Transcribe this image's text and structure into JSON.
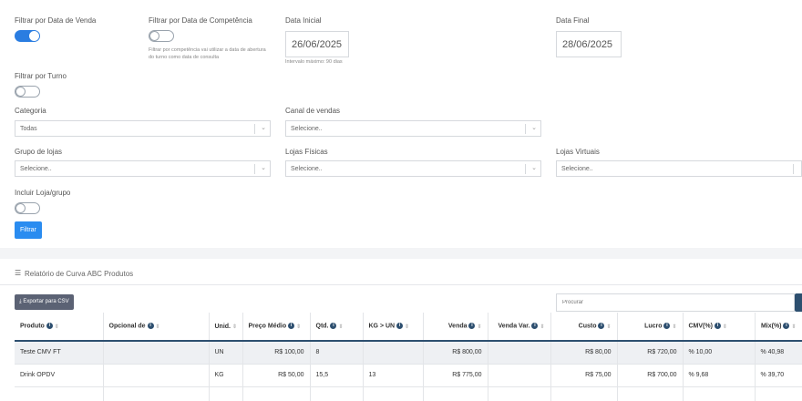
{
  "filters": {
    "data_venda_label": "Filtrar por Data de Venda",
    "data_competencia_label": "Filtrar por Data de Competência",
    "data_competencia_hint": "Filtrar por competência vai utilizar a data de abertura do turno como data de consulta",
    "data_inicial_label": "Data Inicial",
    "data_inicial_value": "26/06/2025",
    "data_inicial_hint": "Intervalo máximo: 90 dias",
    "data_final_label": "Data Final",
    "data_final_value": "28/06/2025",
    "turno_label": "Filtrar por Turno",
    "categoria_label": "Categoria",
    "categoria_value": "Todas",
    "canal_label": "Canal de vendas",
    "canal_value": "Selecione..",
    "grupo_label": "Grupo de lojas",
    "grupo_value": "Selecione..",
    "lojas_fisicas_label": "Lojas Físicas",
    "lojas_fisicas_value": "Selecione..",
    "lojas_virtuais_label": "Lojas Virtuais",
    "lojas_virtuais_value": "Selecione..",
    "incluir_label": "Incluir Loja/grupo",
    "filtrar_button": "Filtrar"
  },
  "report": {
    "title": "Relatório de Curva ABC Produtos",
    "export_button": "Exportar para CSV",
    "search_placeholder": "Procurar",
    "columns": [
      "Produto",
      "Opcional de",
      "Unid.",
      "Preço Médio",
      "Qtd.",
      "KG > UN",
      "Venda",
      "Venda Var.",
      "Custo",
      "Lucro",
      "CMV(%)",
      "Mix(%)"
    ],
    "rows": [
      {
        "produto": "Teste CMV FT",
        "opcional": "",
        "unid": "UN",
        "preco": "R$ 100,00",
        "qtd": "8",
        "kgun": "",
        "venda": "R$ 800,00",
        "venda_var": "",
        "custo": "R$ 80,00",
        "lucro": "R$ 720,00",
        "cmv": "% 10,00",
        "mix": "% 40,98"
      },
      {
        "produto": "Drink OPDV",
        "opcional": "",
        "unid": "KG",
        "preco": "R$ 50,00",
        "qtd": "15,5",
        "kgun": "13",
        "venda": "R$ 775,00",
        "venda_var": "",
        "custo": "R$ 75,00",
        "lucro": "R$ 700,00",
        "cmv": "% 9,68",
        "mix": "% 39,70"
      }
    ]
  },
  "colors": {
    "accent": "#2a7de1",
    "header_border": "#2d4f6f",
    "export_button": "#5b6274"
  }
}
